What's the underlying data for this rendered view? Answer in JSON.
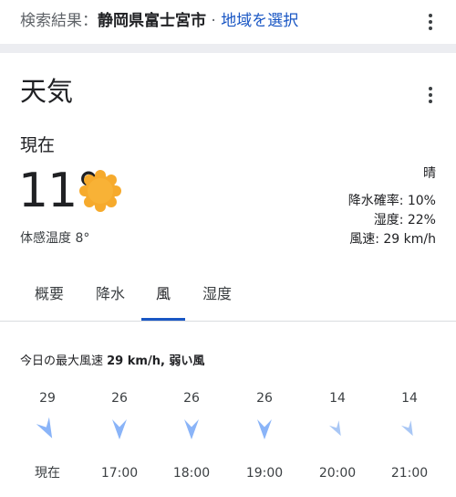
{
  "search": {
    "prefix": "検索結果：",
    "location": "静岡県富士宮市",
    "separator": " · ",
    "link": "地域を選択"
  },
  "card": {
    "title": "天気",
    "now_label": "現在",
    "temperature": "11°",
    "feels_like": "体感温度 8°",
    "condition": "晴",
    "precip": "降水確率: 10%",
    "humidity": "湿度: 22%",
    "wind": "風速: 29 km/h"
  },
  "tabs": [
    {
      "label": "概要"
    },
    {
      "label": "降水"
    },
    {
      "label": "風",
      "active": true
    },
    {
      "label": "湿度"
    }
  ],
  "wind_panel": {
    "heading_prefix": "今日の最大風速 ",
    "heading_bold": "29 km/h, 弱い風",
    "columns": [
      {
        "speed": "29",
        "time": "現在",
        "arrow": "wind-arrow-icon",
        "strength": "strong"
      },
      {
        "speed": "26",
        "time": "17:00",
        "arrow": "wind-arrow-icon",
        "strength": "strong"
      },
      {
        "speed": "26",
        "time": "18:00",
        "arrow": "wind-arrow-icon",
        "strength": "strong"
      },
      {
        "speed": "26",
        "time": "19:00",
        "arrow": "wind-arrow-icon",
        "strength": "strong"
      },
      {
        "speed": "14",
        "time": "20:00",
        "arrow": "wind-arrow-icon",
        "strength": "light"
      },
      {
        "speed": "14",
        "time": "21:00",
        "arrow": "wind-arrow-icon",
        "strength": "light"
      }
    ]
  },
  "colors": {
    "accent": "#1a57c4",
    "arrow": "#8ab4f8",
    "sun": "#f6aa2c"
  }
}
